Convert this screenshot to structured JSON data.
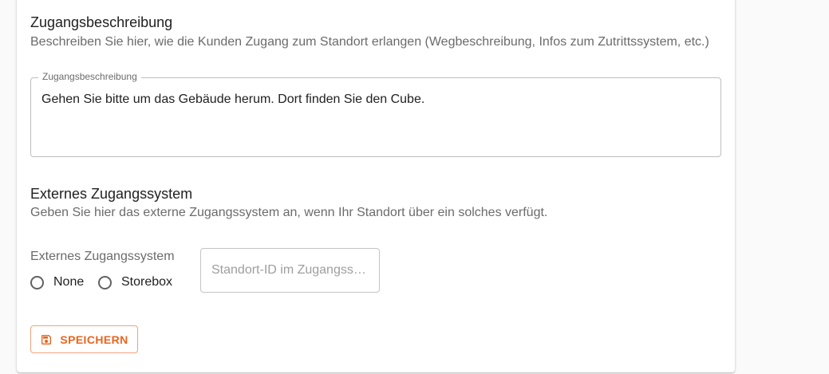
{
  "access_description": {
    "title": "Zugangsbeschreibung",
    "description": "Beschreiben Sie hier, wie die Kunden Zugang zum Standort erlangen (Wegbeschreibung, Infos zum Zutrittssystem, etc.)",
    "field_label": "Zugangsbeschreibung",
    "field_value": "Gehen Sie bitte um das Gebäude herum. Dort finden Sie den Cube."
  },
  "external_system": {
    "title": "Externes Zugangssystem",
    "description": "Geben Sie hier das externe Zugangssystem an, wenn Ihr Standort über ein solches verfügt.",
    "radio_group_label": "Externes Zugangssystem",
    "options": [
      {
        "label": "None",
        "selected": false
      },
      {
        "label": "Storebox",
        "selected": false
      }
    ],
    "location_id_placeholder": "Standort-ID im Zugangssystem"
  },
  "actions": {
    "save_label": "SPEICHERN",
    "save_icon": "save-icon"
  },
  "colors": {
    "accent": "#e8651f",
    "accent_border": "#f0a37a"
  }
}
